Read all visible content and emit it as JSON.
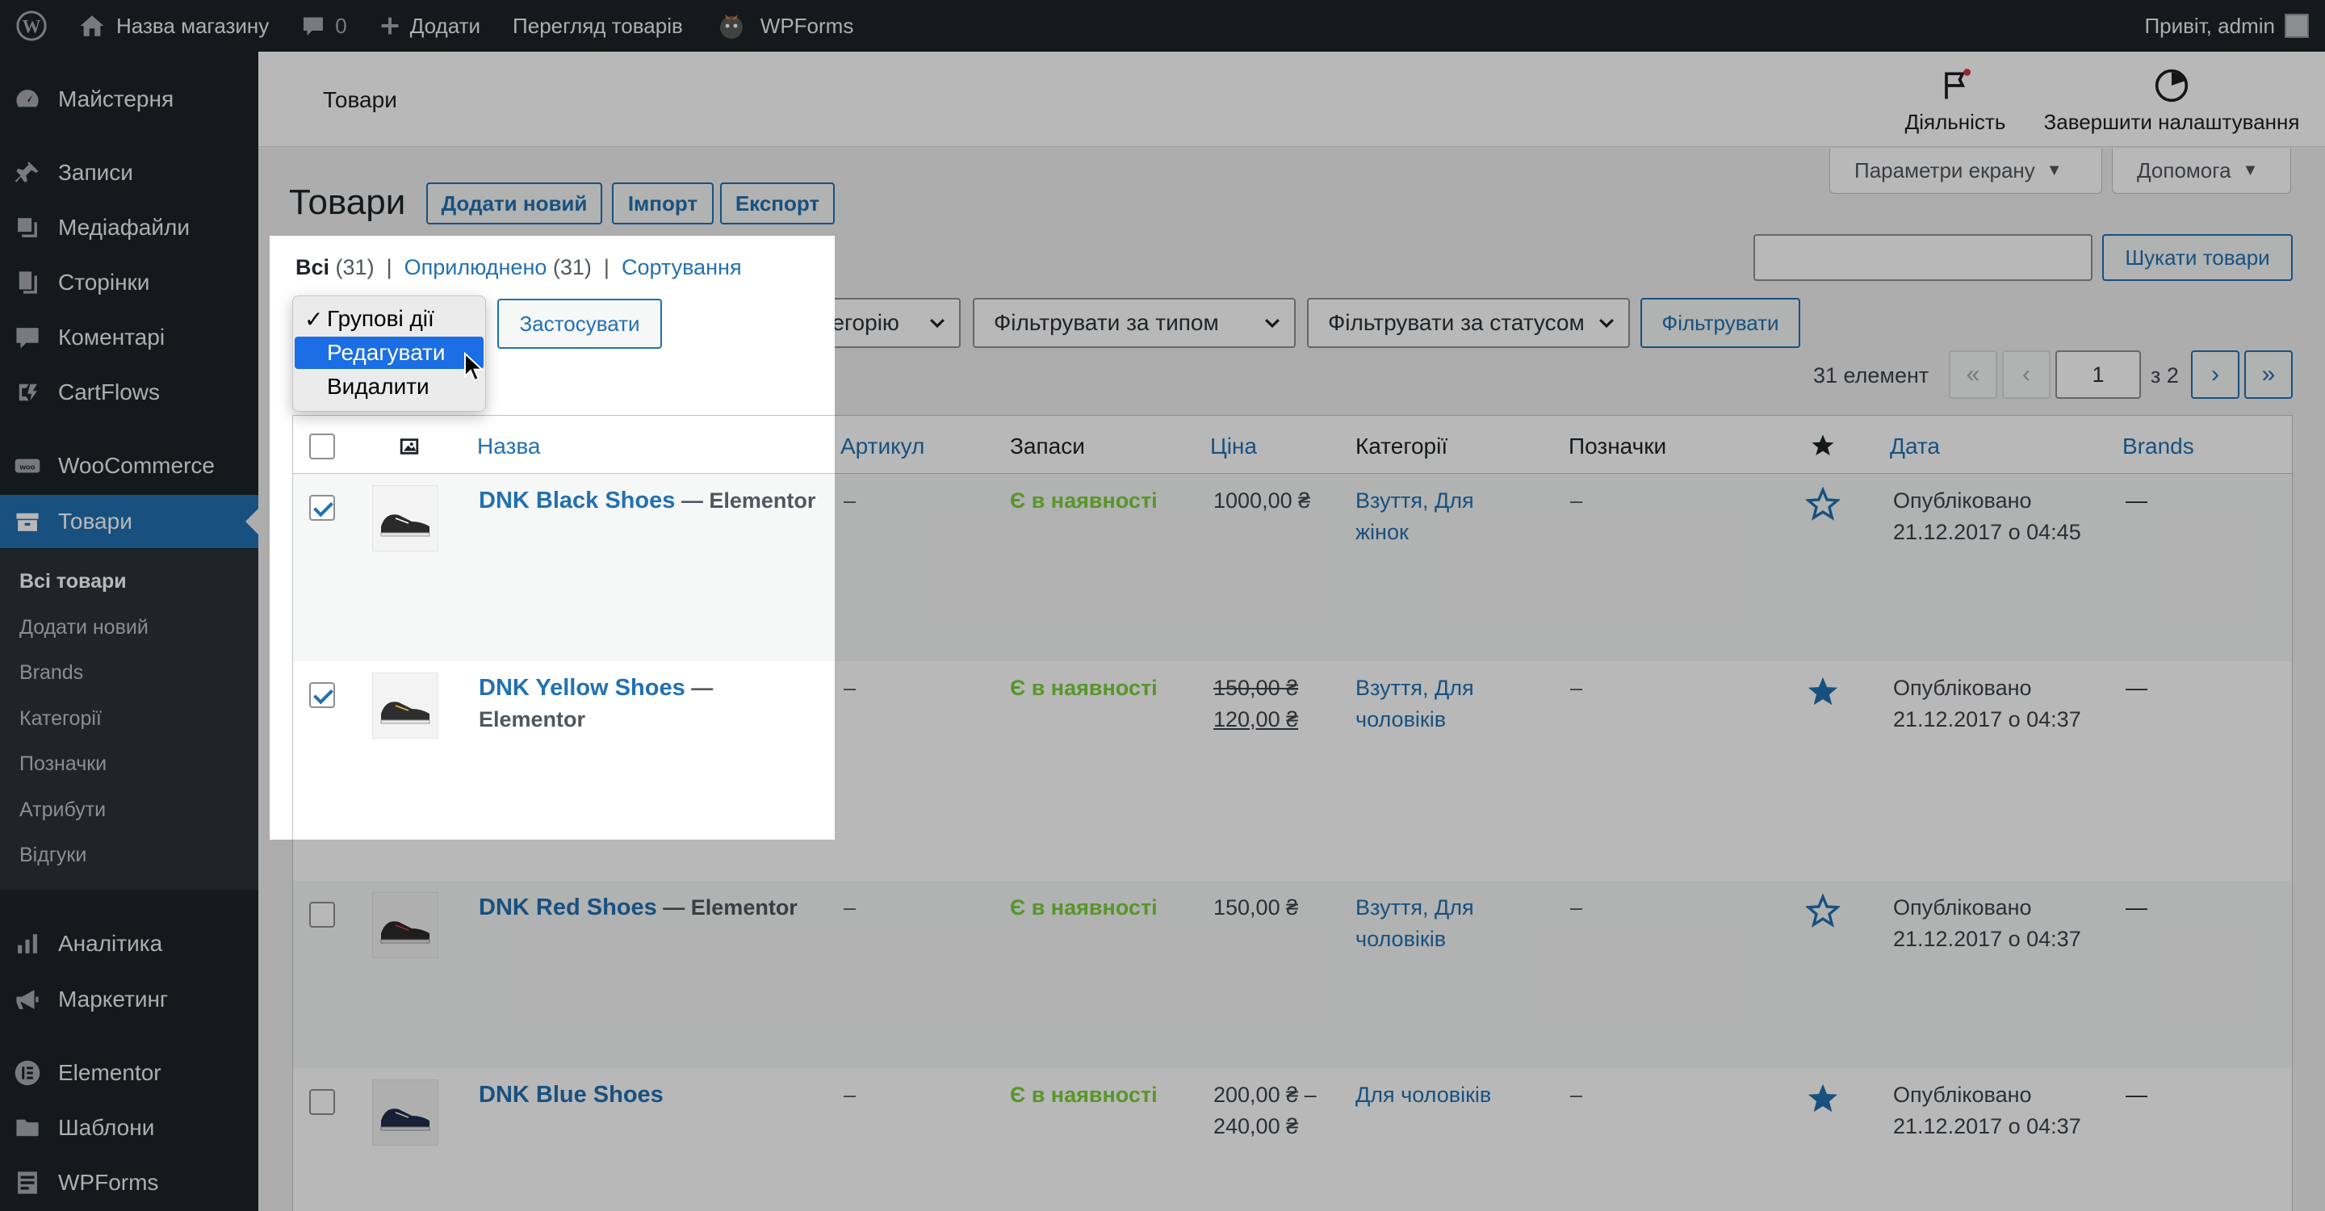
{
  "admin_bar": {
    "site_name": "Назва магазину",
    "comments_count": "0",
    "add_new": "Додати",
    "view_products": "Перегляд товарів",
    "wpforms": "WPForms",
    "greeting": "Привіт, admin"
  },
  "sidebar": {
    "items": [
      {
        "label": "Майстерня",
        "icon": "dashboard-icon"
      },
      {
        "label": "Записи",
        "icon": "pin-icon"
      },
      {
        "label": "Медіафайли",
        "icon": "media-icon"
      },
      {
        "label": "Сторінки",
        "icon": "pages-icon"
      },
      {
        "label": "Коментарі",
        "icon": "comment-icon"
      },
      {
        "label": "CartFlows",
        "icon": "cartflows-icon"
      },
      {
        "label": "WooCommerce",
        "icon": "woo-icon"
      },
      {
        "label": "Товари",
        "icon": "products-icon"
      },
      {
        "label": "Аналітика",
        "icon": "chart-icon"
      },
      {
        "label": "Маркетинг",
        "icon": "megaphone-icon"
      },
      {
        "label": "Elementor",
        "icon": "elementor-icon"
      },
      {
        "label": "Шаблони",
        "icon": "folder-icon"
      },
      {
        "label": "WPForms",
        "icon": "forms-icon"
      }
    ],
    "submenu": [
      "Всі товари",
      "Додати новий",
      "Brands",
      "Категорії",
      "Позначки",
      "Атрибути",
      "Відгуки"
    ]
  },
  "header": {
    "title": "Товари",
    "activity": "Діяльність",
    "finish_setup": "Завершити налаштування",
    "screen_options": "Параметри екрану",
    "help": "Допомога"
  },
  "page": {
    "title": "Товари",
    "add_new": "Додати новий",
    "import": "Імпорт",
    "export": "Експорт",
    "views": {
      "all": "Всі",
      "all_count": "(31)",
      "published": "Оприлюднено",
      "published_count": "(31)",
      "sorting": "Сортування"
    },
    "search_button": "Шукати товари",
    "apply": "Застосувати",
    "category_filter": "Оберіть категорію",
    "type_filter": "Фільтрувати за типом",
    "status_filter": "Фільтрувати за статусом",
    "filter_button": "Фільтрувати",
    "items_count": "31 елемент",
    "current_page": "1",
    "of_pages": "з 2"
  },
  "bulk_dropdown": {
    "selected": "Групові дії",
    "options": [
      "Групові дії",
      "Редагувати",
      "Видалити"
    ]
  },
  "table": {
    "columns": {
      "name": "Назва",
      "sku": "Артикул",
      "stock": "Запаси",
      "price": "Ціна",
      "categories": "Категорії",
      "tags": "Позначки",
      "date": "Дата",
      "brands": "Brands"
    },
    "rows": [
      {
        "name": "DNK Black Shoes",
        "type": "— Elementor",
        "sku": "–",
        "stock": "Є в наявності",
        "price": "1000,00 ₴",
        "price2": "",
        "categories": "Взуття, Для",
        "categories2": "жінок",
        "tags": "–",
        "featured": false,
        "status": "Опубліковано",
        "date": "21.12.2017 о 04:45",
        "brands": "—",
        "checked": true
      },
      {
        "name": "DNK Yellow Shoes",
        "type": "—",
        "type2": "Elementor",
        "sku": "–",
        "stock": "Є в наявності",
        "price_old": "150,00 ₴",
        "price": "120,00 ₴",
        "categories": "Взуття, Для",
        "categories2": "чоловіків",
        "tags": "–",
        "featured": true,
        "status": "Опубліковано",
        "date": "21.12.2017 о 04:37",
        "brands": "—",
        "checked": true
      },
      {
        "name": "DNK Red Shoes",
        "type": "— Elementor",
        "sku": "–",
        "stock": "Є в наявності",
        "price": "150,00 ₴",
        "categories": "Взуття, Для",
        "categories2": "чоловіків",
        "tags": "–",
        "featured": false,
        "status": "Опубліковано",
        "date": "21.12.2017 о 04:37",
        "brands": "—",
        "checked": false
      },
      {
        "name": "DNK Blue Shoes",
        "type": "",
        "sku": "–",
        "stock": "Є в наявності",
        "price": "200,00 ₴ –",
        "price2": "240,00 ₴",
        "categories": "Для чоловіків",
        "categories2": "",
        "tags": "–",
        "featured": true,
        "status": "Опубліковано",
        "date": "21.12.2017 о 04:37",
        "brands": "—",
        "checked": false
      }
    ]
  },
  "colors": {
    "admin_dark": "#1d2327",
    "accent": "#2271b1",
    "in_stock": "#7ad03a",
    "dropdown_highlight": "#1b6ee3"
  }
}
